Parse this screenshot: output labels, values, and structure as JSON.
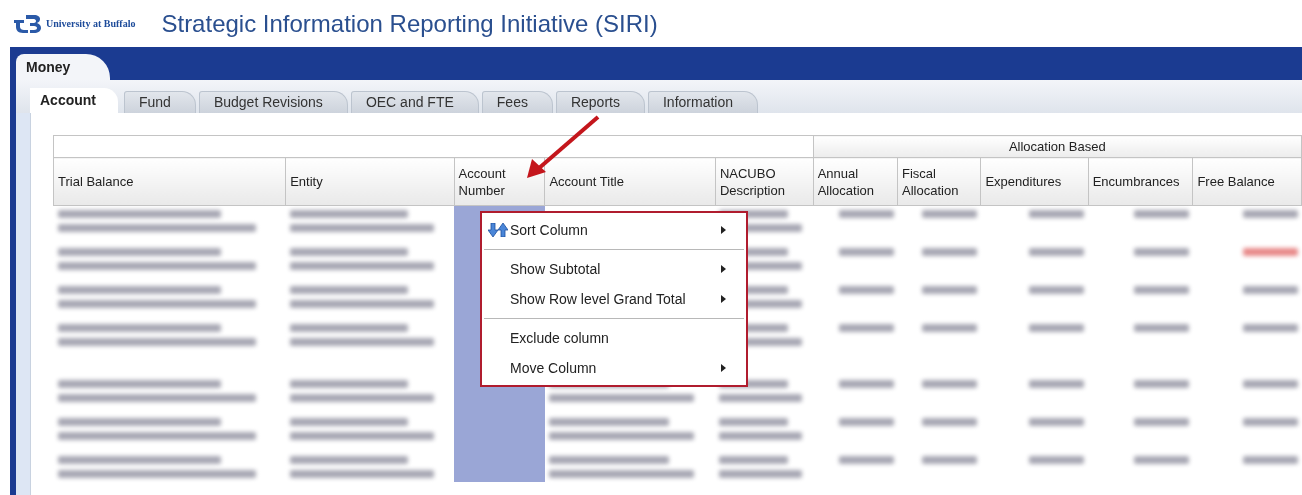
{
  "header": {
    "logo_text": "University at Buffalo",
    "title": "Strategic Information Reporting Initiative (SIRI)"
  },
  "top_tabs": [
    {
      "label": "Money",
      "selected": true
    }
  ],
  "tabs": [
    {
      "label": "Account",
      "selected": true
    },
    {
      "label": "Fund",
      "selected": false
    },
    {
      "label": "Budget Revisions",
      "selected": false
    },
    {
      "label": "OEC and FTE",
      "selected": false
    },
    {
      "label": "Fees",
      "selected": false
    },
    {
      "label": "Reports",
      "selected": false
    },
    {
      "label": "Information",
      "selected": false
    }
  ],
  "table": {
    "group_header": "Allocation Based",
    "columns": [
      {
        "label": "Trial Balance",
        "group": false
      },
      {
        "label": "Entity",
        "group": false
      },
      {
        "label": "Account Number",
        "group": false
      },
      {
        "label": "Account Title",
        "group": false
      },
      {
        "label": "NACUBO Description",
        "group": false
      },
      {
        "label": "Annual Allocation",
        "group": true
      },
      {
        "label": "Fiscal Allocation",
        "group": true
      },
      {
        "label": "Expenditures",
        "group": true
      },
      {
        "label": "Encumbrances",
        "group": true
      },
      {
        "label": "Free Balance",
        "group": true
      }
    ]
  },
  "context_menu": {
    "items": [
      {
        "kind": "icon_item",
        "label": "Sort Column",
        "submenu": true
      },
      {
        "kind": "separator"
      },
      {
        "kind": "item",
        "label": "Show Subtotal",
        "submenu": true
      },
      {
        "kind": "item",
        "label": "Show Row level Grand Total",
        "submenu": true
      },
      {
        "kind": "separator"
      },
      {
        "kind": "item",
        "label": "Exclude column",
        "submenu": false
      },
      {
        "kind": "item",
        "label": "Move Column",
        "submenu": true
      }
    ]
  }
}
